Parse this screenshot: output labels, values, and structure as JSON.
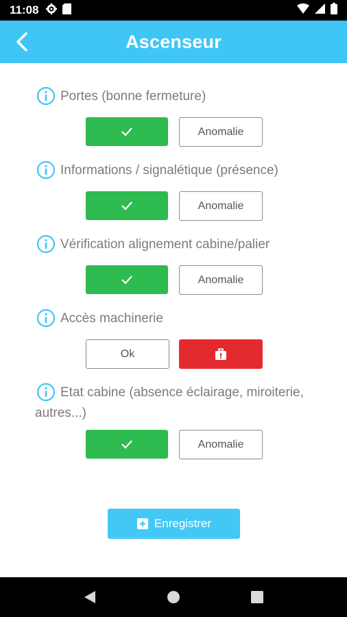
{
  "status_bar": {
    "time": "11:08"
  },
  "header": {
    "title": "Ascenseur"
  },
  "questions": [
    {
      "label": "Portes (bonne fermeture)",
      "ok_label": "",
      "anomaly_label": "Anomalie",
      "selected": "ok"
    },
    {
      "label": "Informations / signalétique (présence)",
      "ok_label": "",
      "anomaly_label": "Anomalie",
      "selected": "ok"
    },
    {
      "label": "Vérification alignement cabine/palier",
      "ok_label": "",
      "anomaly_label": "Anomalie",
      "selected": "ok"
    },
    {
      "label": "Accès machinerie",
      "ok_label": "Ok",
      "anomaly_label": "",
      "selected": "anomaly"
    },
    {
      "label_line1": "Etat cabine (absence éclairage, miroiterie,",
      "label_line2": "autres...)",
      "ok_label": "",
      "anomaly_label": "Anomalie",
      "selected": "ok"
    }
  ],
  "save_button": {
    "label": "Enregistrer"
  },
  "colors": {
    "accent": "#3fc6f6",
    "ok_green": "#2ebb4f",
    "anomaly_red": "#e52a2f",
    "label_gray": "#7b7b7b"
  },
  "icons": {
    "back": "chevron-left-icon",
    "info": "info-circle-icon",
    "check": "check-icon",
    "alert": "alert-box-icon",
    "save": "save-icon"
  }
}
